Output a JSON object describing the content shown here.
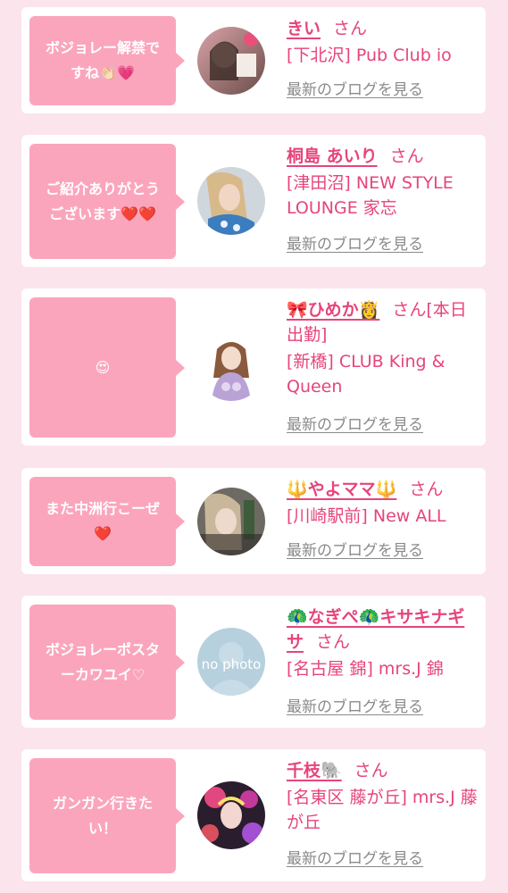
{
  "entries": [
    {
      "message_lines": [
        "ボジョレー解禁で",
        "すね👏🏻💗"
      ],
      "name": "きい",
      "honorific": "さん",
      "shop": "[下北沢] Pub Club io",
      "blog_link": "最新のブログを見る"
    },
    {
      "message_lines": [
        "ご紹介ありがとう",
        "ございます❤️❤️"
      ],
      "name": "桐島 あいり",
      "honorific": "さん",
      "shop": "[津田沼] NEW STYLE LOUNGE 家忘",
      "blog_link": "最新のブログを見る"
    },
    {
      "message_lines": [
        "😍"
      ],
      "name": "🎀ひめか👸",
      "honorific": "さん[本日出勤]",
      "shop": "[新橋] CLUB King & Queen",
      "blog_link": "最新のブログを見る"
    },
    {
      "message_lines": [
        "また中洲行こーぜ",
        "❤️"
      ],
      "name": "🔱やよママ🔱",
      "honorific": "さん",
      "shop": "[川崎駅前] New ALL",
      "blog_link": "最新のブログを見る"
    },
    {
      "message_lines": [
        "ボジョレーポスタ",
        "ーカワユイ♡"
      ],
      "name": "🦚なぎぺ🦚キサキナギサ",
      "honorific": "さん",
      "shop": "[名古屋 錦] mrs.J 錦",
      "blog_link": "最新のブログを見る",
      "avatar_text": "no photo"
    },
    {
      "message_lines": [
        "ガンガン行きた",
        "い！"
      ],
      "name": "千枝🐘",
      "honorific": "さん",
      "shop": "[名東区 藤が丘] mrs.J 藤が丘",
      "blog_link": "最新のブログを見る"
    }
  ]
}
